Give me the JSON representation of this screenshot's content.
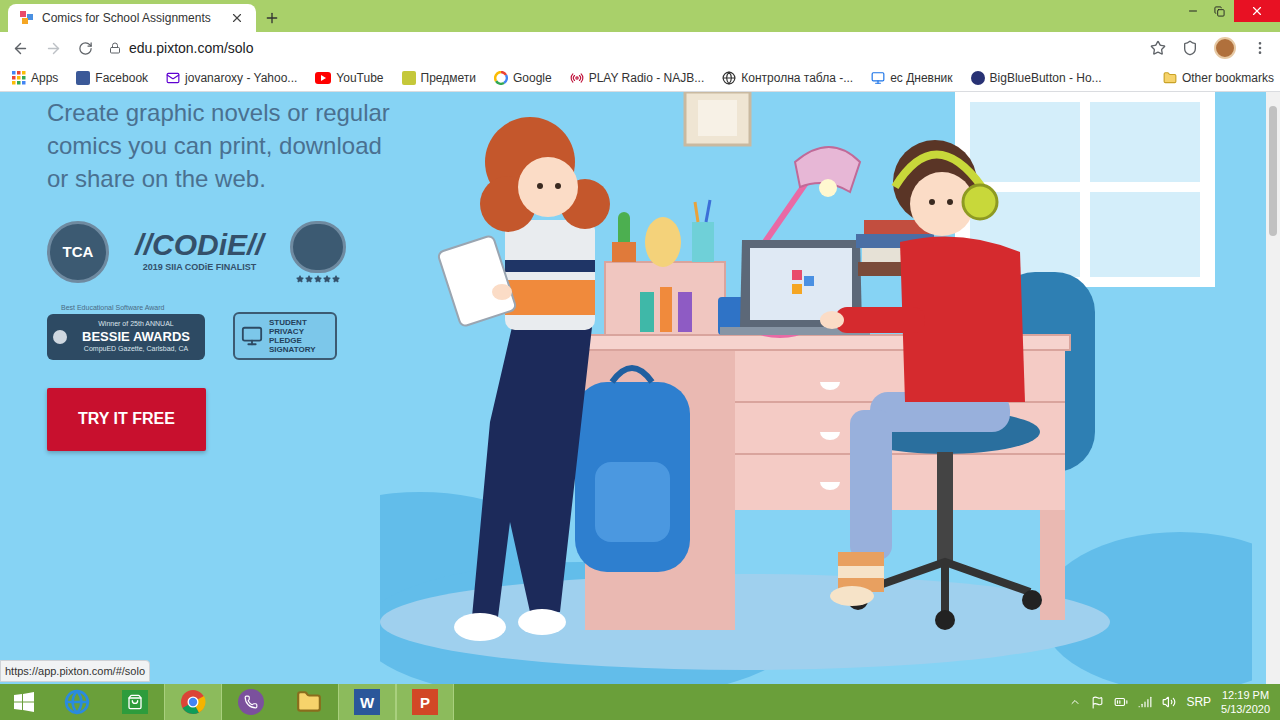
{
  "tabs": [
    {
      "label": "Comics for School Assignments",
      "selected": true
    }
  ],
  "address_bar": {
    "url": "edu.pixton.com/solo"
  },
  "bookmarks": [
    {
      "label": "Apps",
      "kind": "apps"
    },
    {
      "label": "Facebook",
      "kind": "facebook"
    },
    {
      "label": "jovanaroxy - Yahoo...",
      "kind": "mail"
    },
    {
      "label": "YouTube",
      "kind": "youtube"
    },
    {
      "label": "Предмети",
      "kind": "folder"
    },
    {
      "label": "Google",
      "kind": "google"
    },
    {
      "label": "PLAY Radio - NAJB...",
      "kind": "radio"
    },
    {
      "label": "Контролна табла -...",
      "kind": "control"
    },
    {
      "label": "ес Дневник",
      "kind": "diary"
    },
    {
      "label": "BigBlueButton - Ho...",
      "kind": "bbb"
    }
  ],
  "other_bookmarks": {
    "label": "Other bookmarks"
  },
  "hero": {
    "lines": [
      "Create graphic novels or regular",
      "comics you can print, download",
      "or share on the web."
    ]
  },
  "badges": {
    "tca": {
      "label": "TCA"
    },
    "codie": {
      "title": "//CODiE//",
      "subtitle": "2019 SIIA CODiE FINALIST"
    },
    "rating": {
      "stars": 5
    },
    "bessie": {
      "top": "Best Educational Software Award",
      "winner": "Winner of 25th ANNUAL",
      "title": "BESSIE AWARDS",
      "source": "CompuED Gazette, Carlsbad, CA"
    },
    "pledge": {
      "lines": [
        "STUDENT",
        "PRIVACY",
        "PLEDGE",
        "SIGNATORY"
      ]
    }
  },
  "cta_button": {
    "label": "TRY IT FREE"
  },
  "status_link": "https://app.pixton.com/#/solo",
  "taskbar": {
    "apps": [
      {
        "kind": "ie",
        "label": "",
        "running": false
      },
      {
        "kind": "store",
        "label": "",
        "running": false
      },
      {
        "kind": "chrome",
        "label": "",
        "running": true
      },
      {
        "kind": "viber",
        "label": "",
        "running": false
      },
      {
        "kind": "explorer",
        "label": "",
        "running": false
      },
      {
        "kind": "word",
        "label": "W",
        "running": true
      },
      {
        "kind": "powerpoint",
        "label": "P",
        "running": true
      }
    ]
  },
  "tray": {
    "language": "SRP",
    "time": "12:19 PM",
    "date": "5/13/2020"
  }
}
